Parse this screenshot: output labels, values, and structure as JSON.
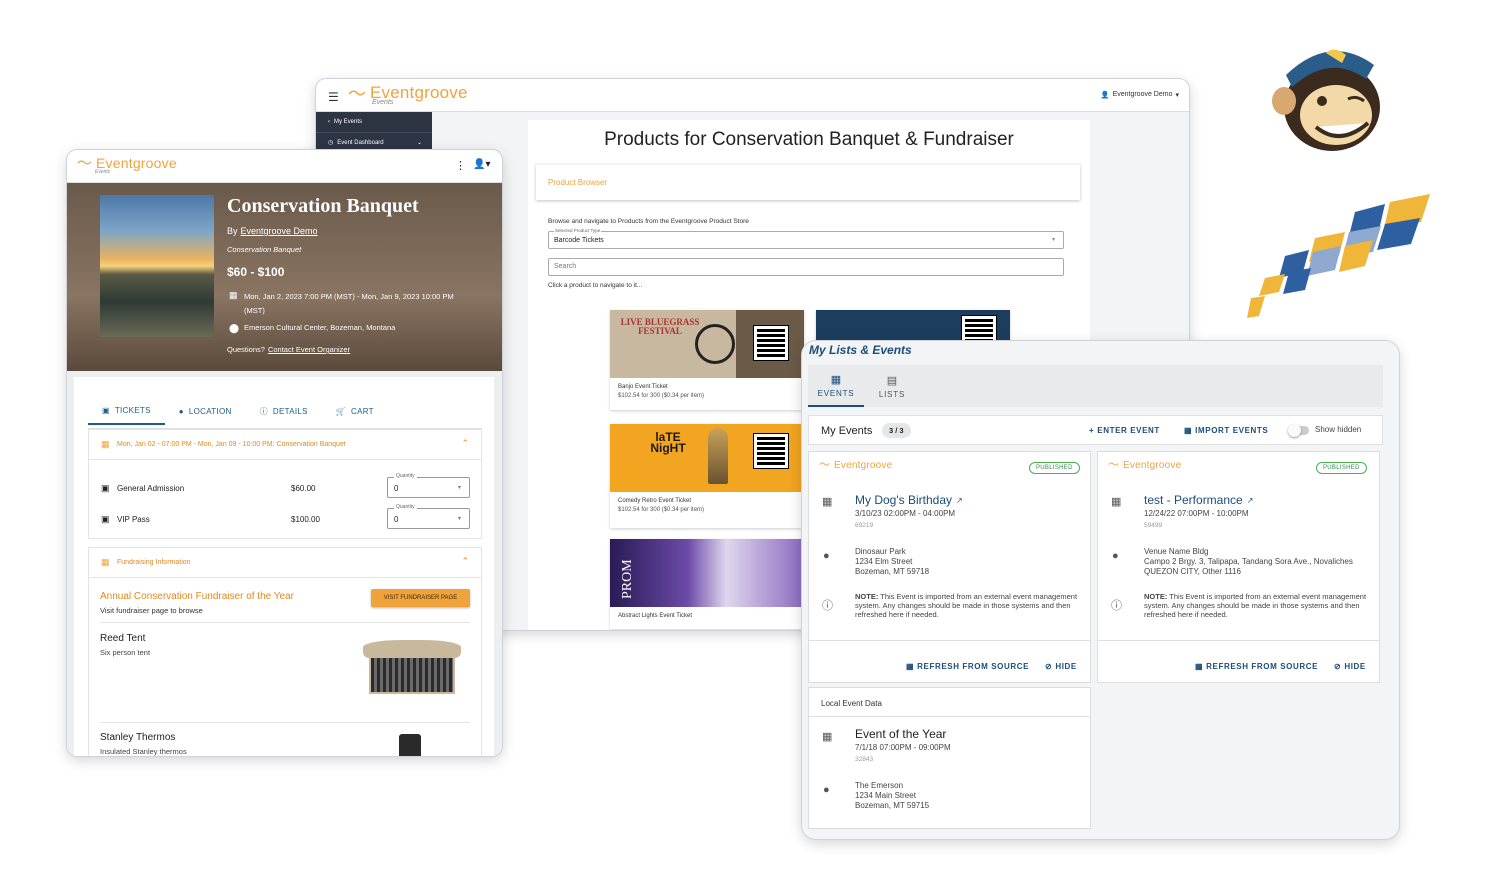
{
  "brand": {
    "name": "Eventgroove",
    "sub": "Events",
    "accent": "#f0a33a"
  },
  "back_window": {
    "user_menu": "Eventgroove Demo",
    "nav": [
      "My Events",
      "Event Dashboard"
    ],
    "title": "Products for Conservation Banquet & Fundraiser",
    "browser_title": "Product Browser",
    "intro": "Browse and navigate to Products from the Eventgroove Product Store",
    "select_label": "Selected Product Type",
    "select_value": "Barcode Tickets",
    "search_placeholder": "Search",
    "hint": "Click a product to navigate to it...",
    "products": [
      {
        "name": "Banjo Event Ticket",
        "price": "$102.54 for 300 ($0.34 per item)",
        "art": "LIVE BLUEGRASS FESTIVAL"
      },
      {
        "name": "Comedy Retro Event Ticket",
        "price": "$102.54 for 300 ($0.34 per item)",
        "art": "laTE NigHT"
      },
      {
        "name": "Abstract Lights Event Ticket",
        "price": "",
        "art": "PROM"
      }
    ]
  },
  "left_window": {
    "event_title": "Conservation Banquet",
    "by": "By",
    "organizer": "Eventgroove Demo",
    "subtitle": "Conservation Banquet",
    "price_range": "$60 - $100",
    "dates": "Mon, Jan 2, 2023 7:00 PM (MST) - Mon, Jan 9, 2023 10:00 PM (MST)",
    "venue": "Emerson Cultural Center, Bozeman, Montana",
    "questions": "Questions?",
    "contact": "Contact Event Organizer",
    "tabs": [
      "TICKETS",
      "LOCATION",
      "DETAILS",
      "CART"
    ],
    "session": "Mon, Jan 02 - 07:00 PM - Mon, Jan 09 - 10:00 PM: Conservation Banquet",
    "tickets": [
      {
        "name": "General Admission",
        "price": "$60.00",
        "qty_label": "Quantity",
        "qty": "0"
      },
      {
        "name": "VIP Pass",
        "price": "$100.00",
        "qty_label": "Quantity",
        "qty": "0"
      }
    ],
    "fundraising_header": "Fundraising Information",
    "fundraiser_title": "Annual Conservation Fundraiser of the Year",
    "fundraiser_sub": "Visit fundraiser page to browse",
    "fundraiser_button": "VISIT FUNDRAISER PAGE",
    "items": [
      {
        "name": "Reed Tent",
        "desc": "Six person tent"
      },
      {
        "name": "Stanley Thermos",
        "desc": "Insulated Stanley thermos"
      }
    ]
  },
  "right_window": {
    "title": "My Lists & Events",
    "tabs": [
      "EVENTS",
      "LISTS"
    ],
    "section": "My Events",
    "count": "3 / 3",
    "enter_event": "ENTER EVENT",
    "import_events": "IMPORT EVENTS",
    "show_hidden": "Show hidden",
    "events": [
      {
        "status": "PUBLISHED",
        "title": "My Dog's Birthday",
        "when": "3/10/23 02:00PM - 04:00PM",
        "id": "69219",
        "addr1": "Dinosaur Park",
        "addr2": "1234 Elm Street",
        "addr3": "Bozeman, MT 59718",
        "note_label": "NOTE:",
        "note": "This Event is imported from an external event management system. Any changes should be made in those systems and then refreshed here if needed.",
        "refresh": "REFRESH FROM SOURCE",
        "hide": "HIDE"
      },
      {
        "status": "PUBLISHED",
        "title": "test - Performance",
        "when": "12/24/22 07:00PM - 10:00PM",
        "id": "59499",
        "addr1": "Venue Name Bldg",
        "addr2": "Campo 2 Brgy. 3, Talipapa, Tandang Sora Ave., Novaliches",
        "addr3": "QUEZON CITY, Other 1116",
        "note_label": "NOTE:",
        "note": "This Event is imported from an external event management system. Any changes should be made in those systems and then refreshed here if needed.",
        "refresh": "REFRESH FROM SOURCE",
        "hide": "HIDE"
      }
    ],
    "local_header": "Local Event Data",
    "local_event": {
      "title": "Event of the Year",
      "when": "7/1/18 07:00PM - 09:00PM",
      "id": "32843",
      "addr1": "The Emerson",
      "addr2": "1234 Main Street",
      "addr3": "Bozeman, MT 59715"
    }
  }
}
